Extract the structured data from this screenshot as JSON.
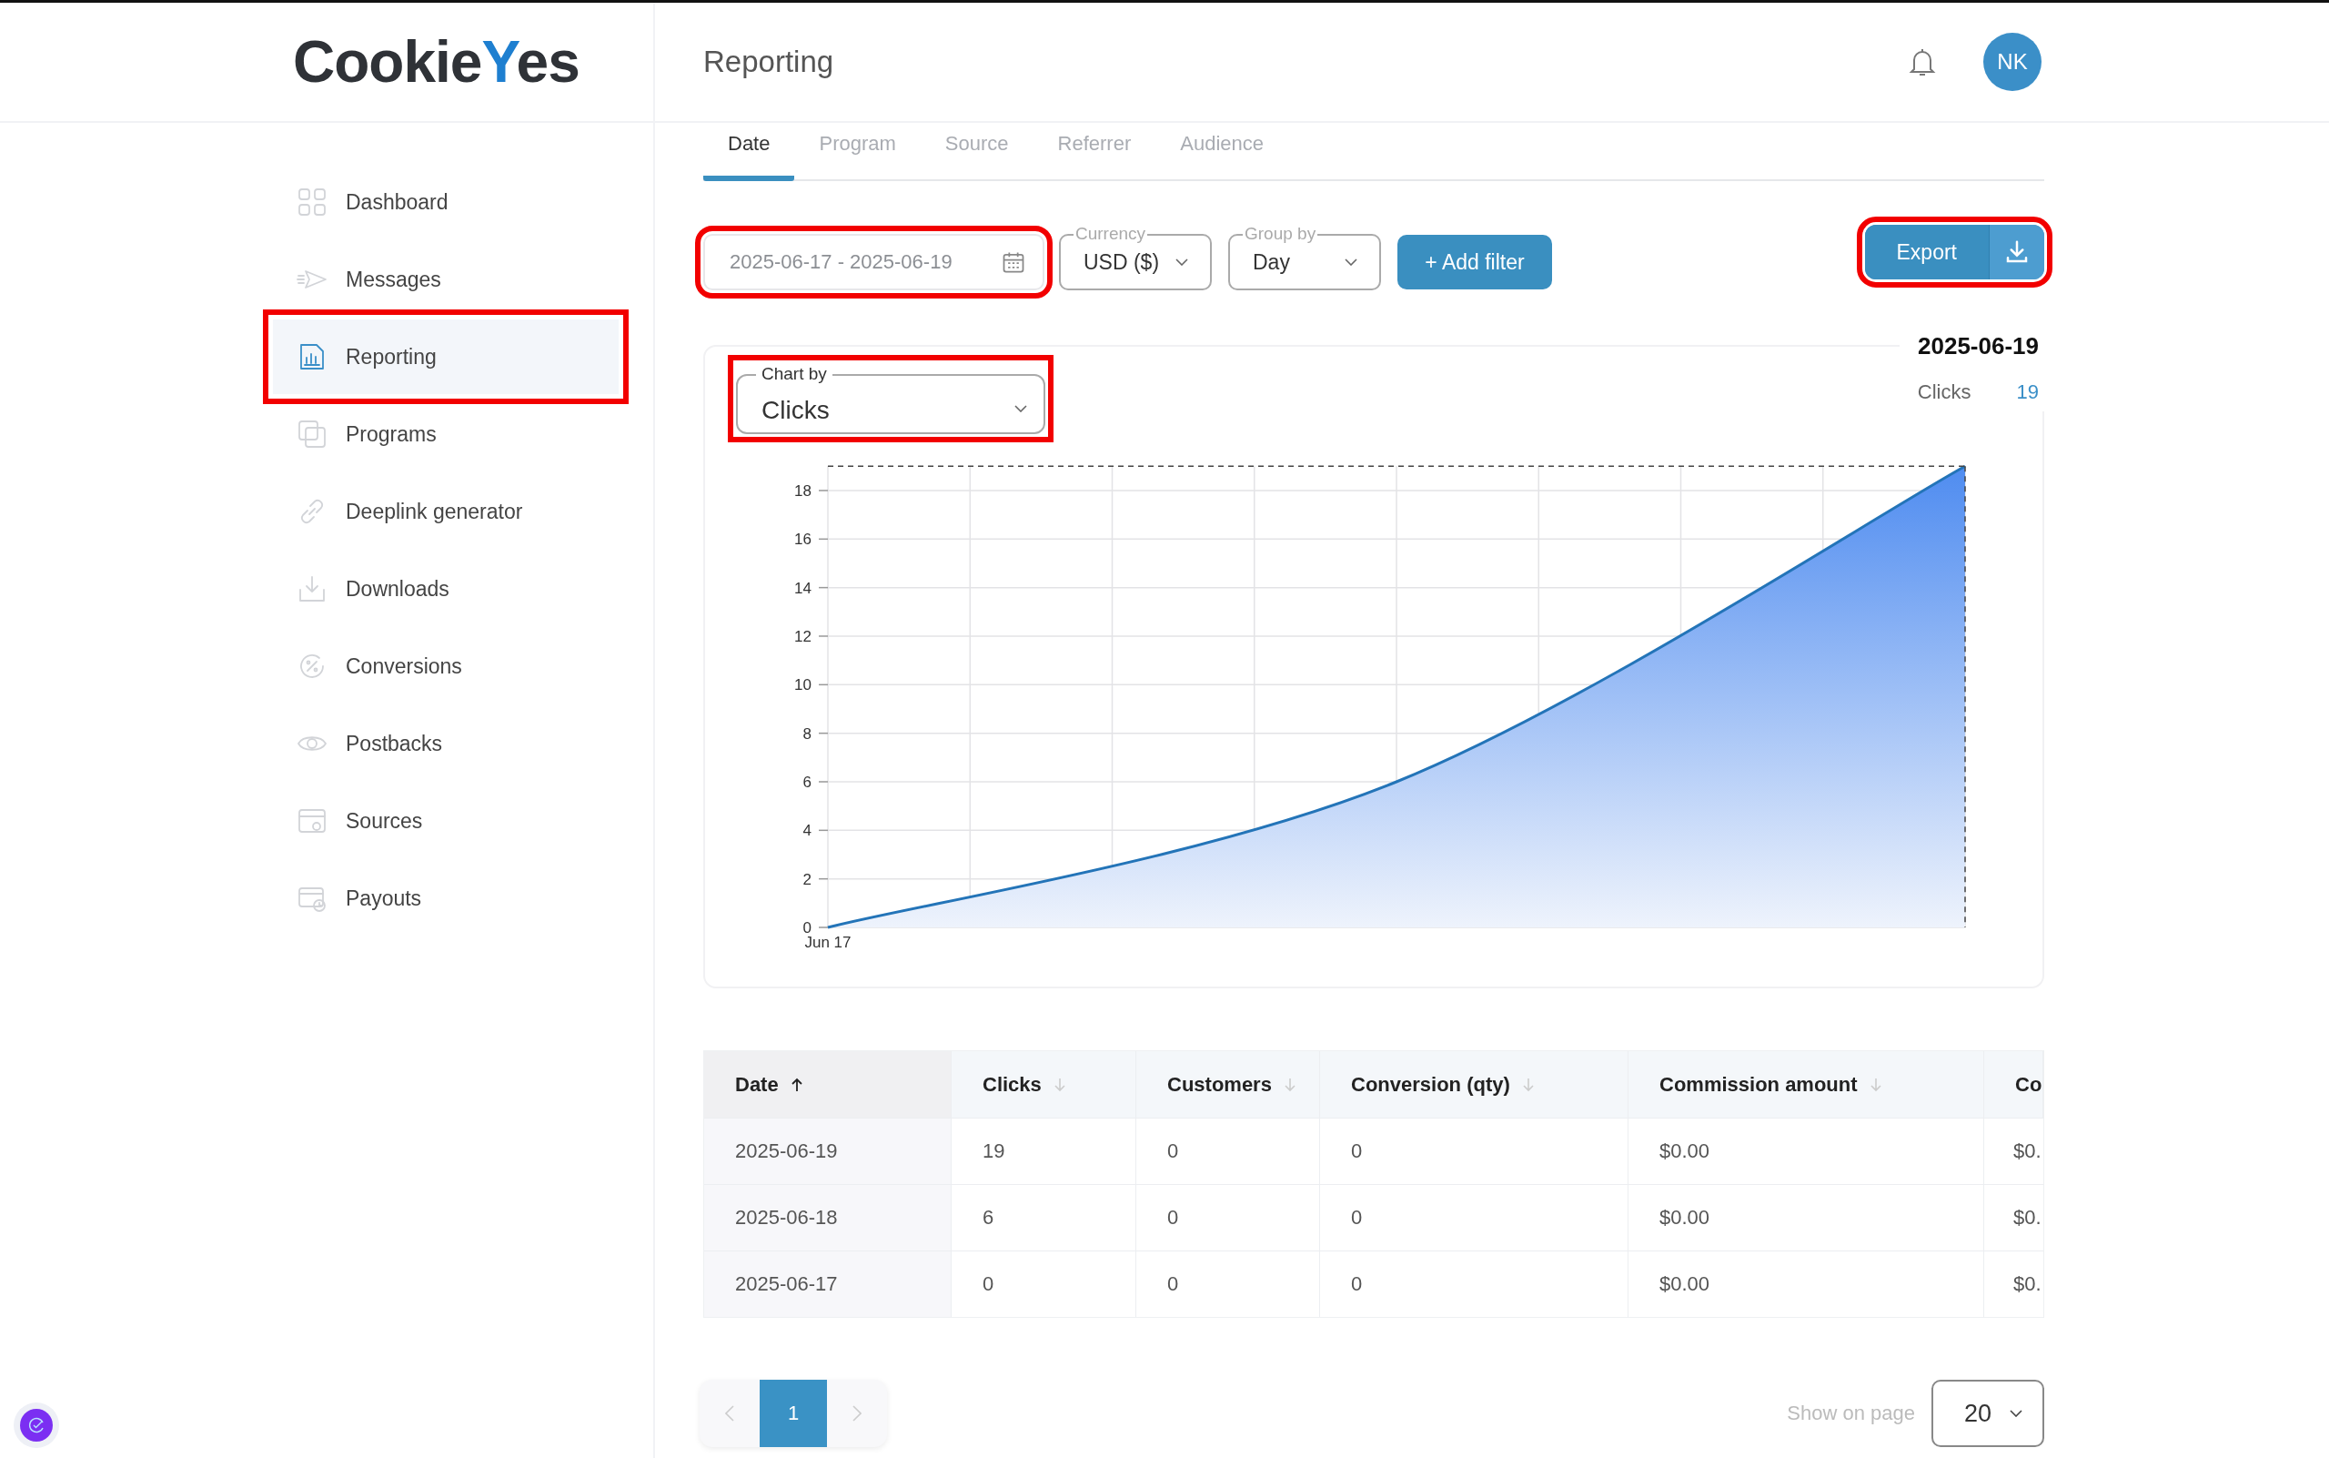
{
  "logo": [
    "Cookie",
    "Y",
    "es"
  ],
  "page_title": "Reporting",
  "user": {
    "initials": "NK"
  },
  "sidebar": {
    "items": [
      {
        "label": "Dashboard",
        "selected": false,
        "highlighted": false
      },
      {
        "label": "Messages",
        "selected": false,
        "highlighted": false
      },
      {
        "label": "Reporting",
        "selected": true,
        "highlighted": true
      },
      {
        "label": "Programs",
        "selected": false,
        "highlighted": false
      },
      {
        "label": "Deeplink generator",
        "selected": false,
        "highlighted": false
      },
      {
        "label": "Downloads",
        "selected": false,
        "highlighted": false
      },
      {
        "label": "Conversions",
        "selected": false,
        "highlighted": false
      },
      {
        "label": "Postbacks",
        "selected": false,
        "highlighted": false
      },
      {
        "label": "Sources",
        "selected": false,
        "highlighted": false
      },
      {
        "label": "Payouts",
        "selected": false,
        "highlighted": false
      }
    ]
  },
  "tabs": [
    {
      "label": "Date",
      "selected": true
    },
    {
      "label": "Program",
      "selected": false
    },
    {
      "label": "Source",
      "selected": false
    },
    {
      "label": "Referrer",
      "selected": false
    },
    {
      "label": "Audience",
      "selected": false
    }
  ],
  "filters": {
    "date_range": {
      "value": "2025-06-17 - 2025-06-19",
      "highlighted": true
    },
    "currency": {
      "label": "Currency",
      "value": "USD ($)"
    },
    "group_by": {
      "label": "Group by",
      "value": "Day"
    },
    "add_filter": "+ Add filter",
    "export": {
      "label": "Export",
      "highlighted": true
    }
  },
  "chart_card": {
    "chart_by": {
      "label": "Chart by",
      "value": "Clicks",
      "highlighted": true
    },
    "tooltip": {
      "date": "2025-06-19",
      "value": "19"
    },
    "chart_data": {
      "type": "area",
      "grid": true,
      "ylim": [
        0,
        19
      ],
      "annotations": [
        "Jun 17"
      ],
      "yticks": [
        0,
        2,
        4,
        6,
        8,
        10,
        12,
        14,
        16,
        18
      ],
      "series": [
        {
          "name": "Clicks",
          "color": "#2374b8",
          "values": [
            0,
            6,
            19
          ]
        }
      ]
    }
  },
  "table": {
    "columns": [
      {
        "label": "Date",
        "sorted": true
      },
      {
        "label": "Clicks",
        "sorted": false
      },
      {
        "label": "Customers",
        "sorted": false
      },
      {
        "label": "Conversion (qty)",
        "sorted": false
      },
      {
        "label": "Commission amount",
        "sorted": false
      },
      {
        "label": "Co"
      }
    ],
    "rows": [
      [
        "2025-06-19",
        "19",
        "0",
        "0",
        "$0.00",
        "$0."
      ],
      [
        "2025-06-18",
        "6",
        "0",
        "0",
        "$0.00",
        "$0."
      ],
      [
        "2025-06-17",
        "0",
        "0",
        "0",
        "$0.00",
        "$0."
      ]
    ]
  },
  "pagination": {
    "pages": [
      {
        "label": "1",
        "selected": true
      }
    ],
    "show_on_page_label": "Show on page",
    "page_size": "20"
  }
}
